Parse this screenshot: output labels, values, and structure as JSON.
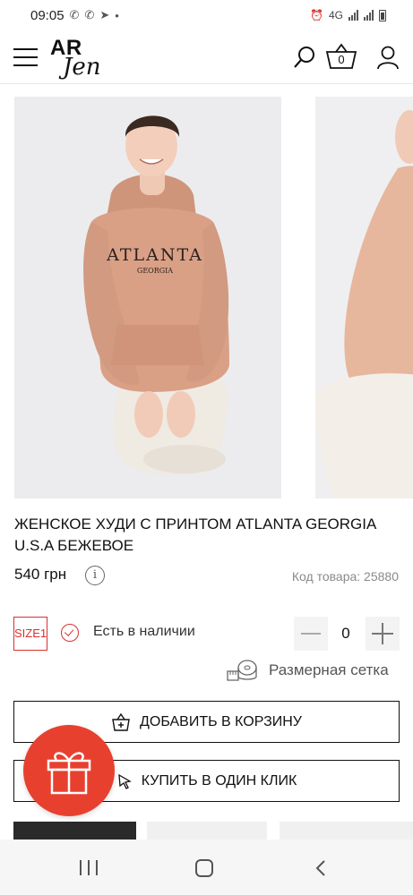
{
  "status_bar": {
    "time": "09:05",
    "network": "4G"
  },
  "header": {
    "logo_top": "AR",
    "logo_bottom": "Jen",
    "cart_count": "0"
  },
  "product": {
    "title": "ЖЕНСКОЕ ХУДИ С ПРИНТОМ ATLANTA GEORGIA U.S.A БЕЖЕВОЕ",
    "price": "540 грн",
    "info_icon": "i",
    "sku": "Код товара: 25880",
    "size": "SIZE1",
    "stock": "Есть в наличии",
    "quantity": "0",
    "size_chart": "Размерная сетка",
    "print_text": "ATLANTA",
    "print_sub": "GEORGIA"
  },
  "buttons": {
    "add_to_cart": "ДОБАВИТЬ В КОРЗИНУ",
    "buy_one_click": "КУПИТЬ В ОДИН КЛИК"
  },
  "colors": {
    "accent": "#e8402f",
    "size_border": "#d8312f",
    "hoodie": "#d9a086"
  }
}
